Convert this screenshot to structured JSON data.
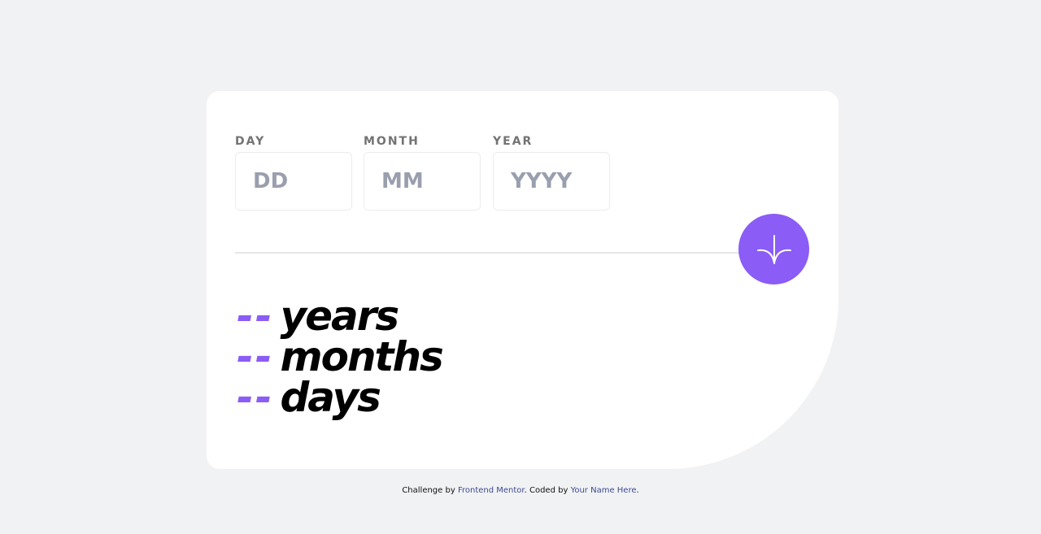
{
  "form": {
    "day": {
      "label": "DAY",
      "placeholder": "DD",
      "value": ""
    },
    "month": {
      "label": "MONTH",
      "placeholder": "MM",
      "value": ""
    },
    "year": {
      "label": "YEAR",
      "placeholder": "YYYY",
      "value": ""
    },
    "submit_icon": "arrow-down-icon"
  },
  "results": [
    {
      "value": "--",
      "unit": "years"
    },
    {
      "value": "--",
      "unit": "months"
    },
    {
      "value": "--",
      "unit": "days"
    }
  ],
  "footer": {
    "challenge_prefix": "Challenge by",
    "challenge_link": "Frontend Mentor",
    "coded_prefix": ". Coded by",
    "coded_link": "Your Name Here",
    "suffix": "."
  },
  "colors": {
    "accent": "#8b5cf6",
    "background": "#f1f2f4",
    "card": "#ffffff",
    "link": "#3d4b91",
    "label": "#737373"
  }
}
